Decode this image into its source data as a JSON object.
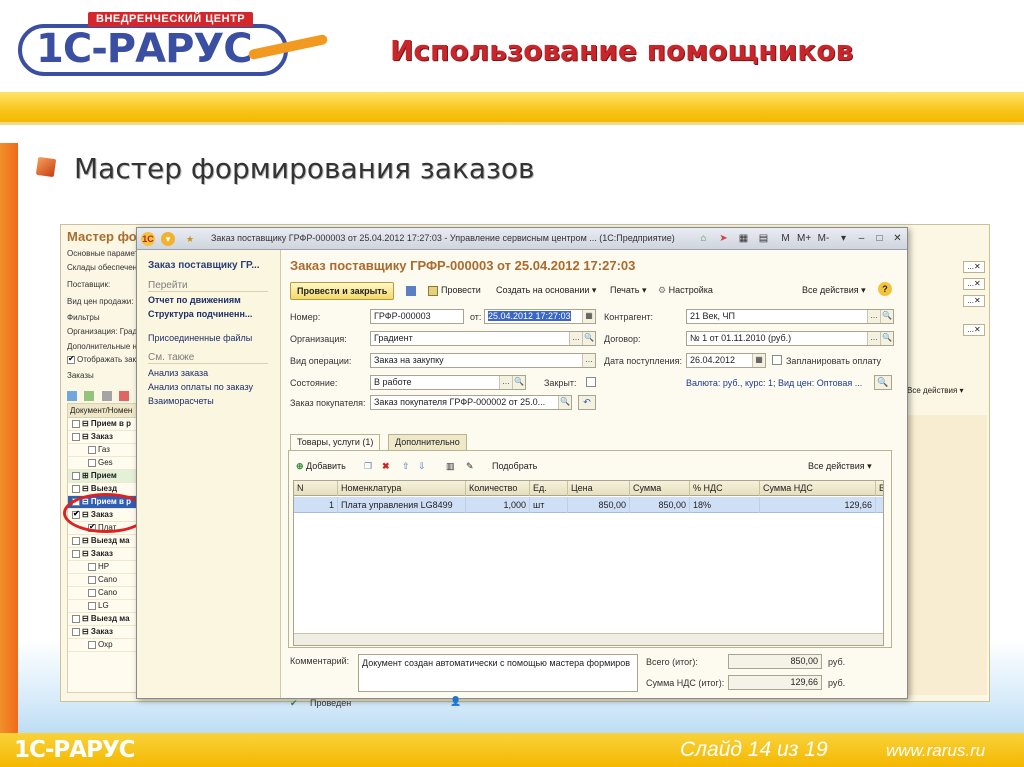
{
  "slide": {
    "logo_top": "ВНЕДРЕНЧЕСКИЙ ЦЕНТР",
    "logo_main": "1С-РАРУС",
    "title": "Использование  помощников",
    "subtitle": "Мастер формирования заказов",
    "footer_logo": "1С-РАРУС",
    "footer_slide": "Слайд 14 из  19",
    "footer_url": "www.rarus.ru",
    "colors": {
      "title_red": "#c8262b",
      "band_yellow": "#f8c51b",
      "left_orange": "#ef6a1c",
      "logo_blue": "#3a4ea2"
    }
  },
  "background_window": {
    "title": "Мастер фор",
    "labels": [
      "Основные парамет",
      "Склады обеспечен",
      "Поставщик:",
      "Вид цен продажи:",
      "Фильтры",
      "Организация:  Град",
      "Дополнительные н",
      "Отображать зака",
      "Заказы"
    ],
    "actions": "Все действия ▾",
    "tree_header": "Документ/Номен",
    "tree_rows": [
      {
        "text": "⊟ Прием в р",
        "style": "bold"
      },
      {
        "text": "⊟ Заказ",
        "style": "bold"
      },
      {
        "text": "Газ",
        "style": "plain"
      },
      {
        "text": "Ges",
        "style": "plain"
      },
      {
        "text": "⊞ Прием",
        "style": "green"
      },
      {
        "text": "⊟ Выезд",
        "style": "bold"
      },
      {
        "text": "⊟ Прием в р",
        "style": "blue"
      },
      {
        "text": "⊟ Заказ",
        "style": "bold"
      },
      {
        "text": "Плат",
        "style": "plain"
      },
      {
        "text": "⊟ Выезд ма",
        "style": "bold"
      },
      {
        "text": "⊟ Заказ",
        "style": "bold"
      },
      {
        "text": "HP",
        "style": "plain"
      },
      {
        "text": "Cano",
        "style": "plain"
      },
      {
        "text": "Cano",
        "style": "plain"
      },
      {
        "text": "LG",
        "style": "plain"
      },
      {
        "text": "⊟ Выезд ма",
        "style": "bold"
      },
      {
        "text": "⊟ Заказ",
        "style": "bold"
      },
      {
        "text": "Охр",
        "style": "plain"
      }
    ]
  },
  "window": {
    "title": "Заказ поставщику ГРФР-000003 от 25.04.2012 17:27:03 - Управление сервисным центром ...  (1С:Предприятие)",
    "app_icon": "1С"
  },
  "nav": {
    "header": "Заказ поставщику ГР...",
    "goto_section": "Перейти",
    "goto_links": [
      "Отчет по движениям",
      "Структура подчиненн...",
      "Присоединенные файлы"
    ],
    "see_section": "См. также",
    "see_links": [
      "Анализ заказа",
      "Анализ оплаты по заказу",
      "Взаиморасчеты"
    ]
  },
  "form": {
    "title": "Заказ поставщику ГРФР-000003 от 25.04.2012 17:27:03",
    "toolbar": {
      "post_close": "Провести и закрыть",
      "post": "Провести",
      "create_based": "Создать на основании ▾",
      "print": "Печать ▾",
      "settings": "Настройка",
      "all_actions": "Все действия ▾",
      "help": "?"
    },
    "fields": {
      "number_label": "Номер:",
      "number": "ГРФР-000003",
      "date_label": "от:",
      "date": "25.04.2012 17:27:03",
      "org_label": "Организация:",
      "org": "Градиент",
      "optype_label": "Вид операции:",
      "optype": "Заказ на закупку",
      "state_label": "Состояние:",
      "state": "В работе",
      "closed_label": "Закрыт:",
      "customer_order_label": "Заказ покупателя:",
      "customer_order": "Заказ покупателя ГРФР-000002 от 25.0...",
      "contractor_label": "Контрагент:",
      "contractor": "21 Век, ЧП",
      "contract_label": "Договор:",
      "contract": "№ 1 от 01.11.2010 (руб.)",
      "receipt_label": "Дата поступления:",
      "receipt_date": "26.04.2012",
      "plan_payment_label": "Запланировать оплату",
      "currency_info": "Валюта: руб., курс: 1; Вид цен: Оптовая ..."
    },
    "tabs": [
      "Товары, услуги (1)",
      "Дополнительно"
    ],
    "grid_toolbar": {
      "add": "Добавить",
      "pick": "Подобрать",
      "all_actions": "Все действия ▾"
    },
    "grid": {
      "columns": [
        "N",
        "Номенклатура",
        "Количество",
        "Ед.",
        "Цена",
        "Сумма",
        "% НДС",
        "Сумма НДС",
        "В"
      ],
      "rows": [
        [
          "1",
          "Плата управления  LG8499",
          "1,000",
          "шт",
          "850,00",
          "850,00",
          "18%",
          "129,66",
          ""
        ]
      ]
    },
    "comment_label": "Комментарий:",
    "comment": "Документ создан автоматически с помощью мастера формиров",
    "total_label": "Всего (итог):",
    "total": "850,00",
    "vat_label": "Сумма НДС (итог):",
    "vat": "129,66",
    "currency": "руб.",
    "status": "Проведен"
  }
}
